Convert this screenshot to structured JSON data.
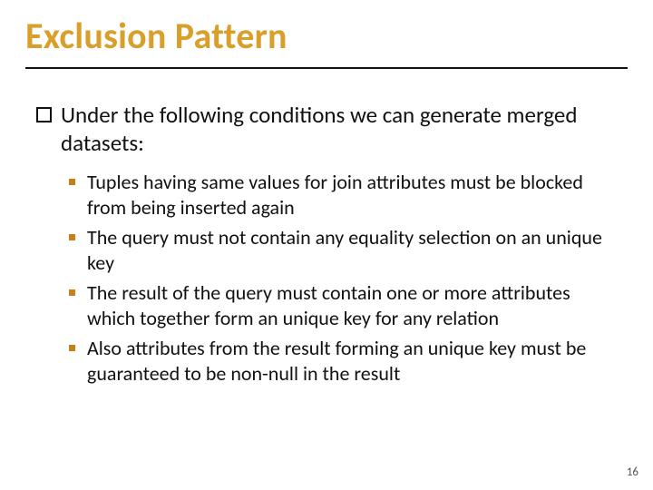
{
  "title": "Exclusion Pattern",
  "intro": "Under the following conditions we can generate merged datasets:",
  "bullets": [
    "Tuples having same values for join attributes must be blocked from being inserted again",
    "The query must not contain any equality selection on an unique key",
    "The result of the query must contain one or more attributes which together form an unique key for any relation",
    "Also attributes from the result forming an unique key must be guaranteed to be non-null in the result"
  ],
  "page_number": "16"
}
